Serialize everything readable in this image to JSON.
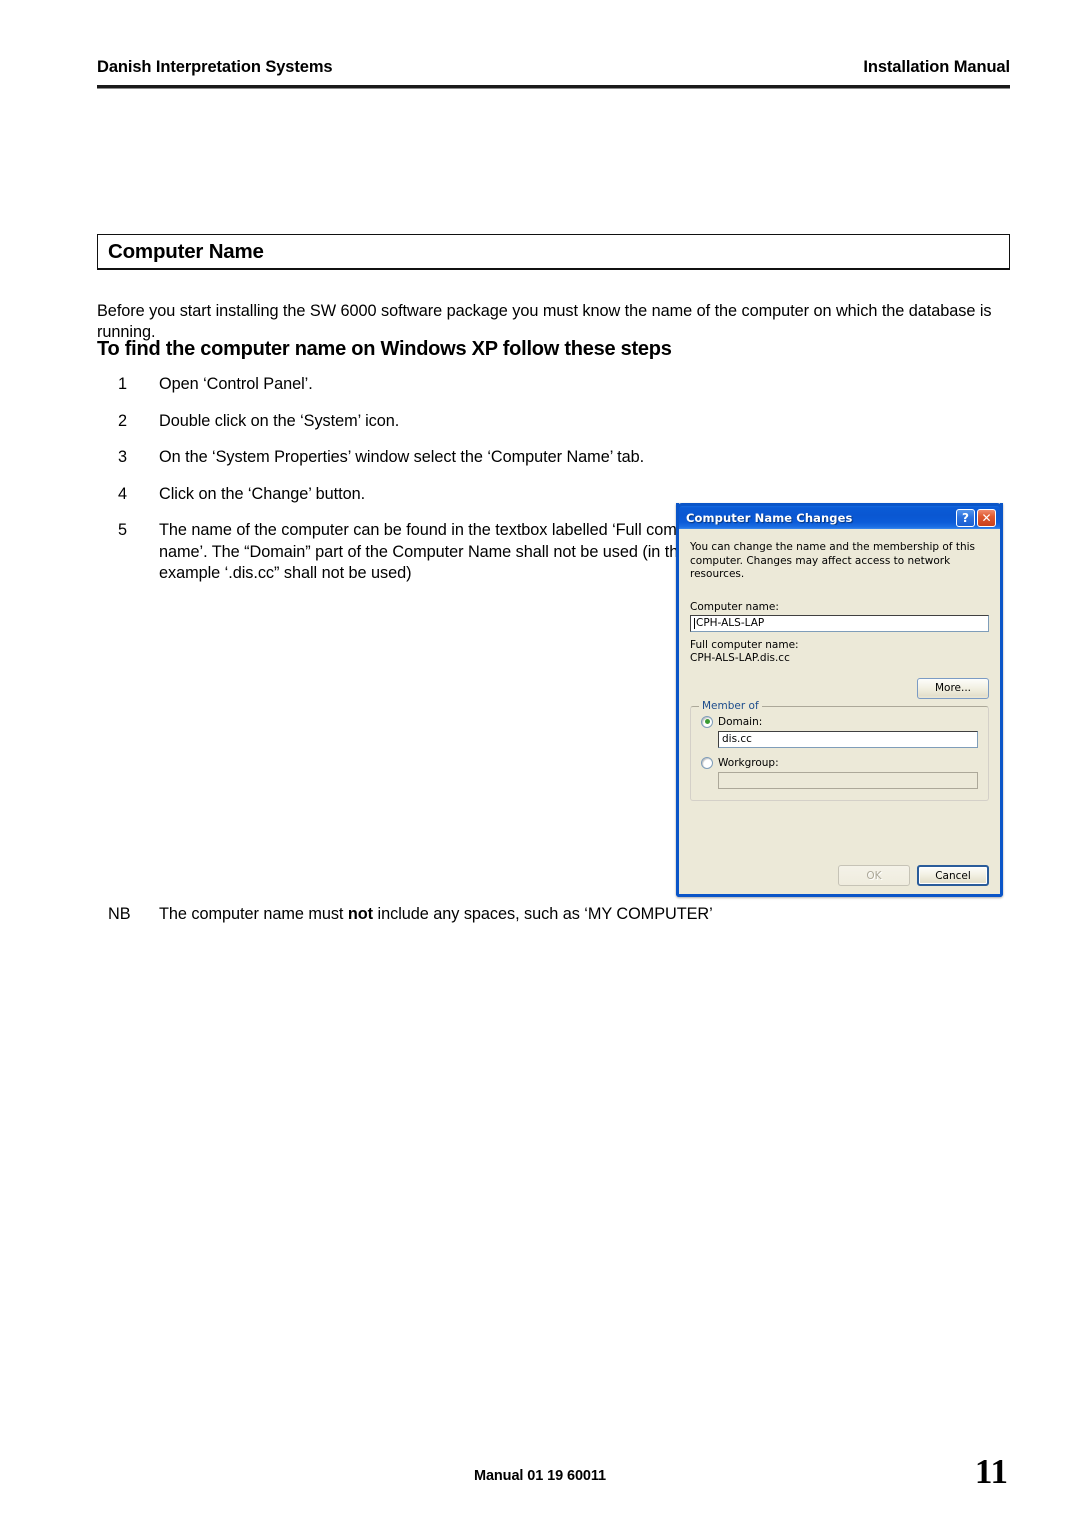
{
  "header": {
    "left": "Danish Interpretation Systems",
    "right": "Installation Manual"
  },
  "section": {
    "heading": "Computer Name",
    "intro": "Before you start installing the SW 6000 software package you must know the name of the computer on which the database is running.",
    "subheading": "To find the computer name on Windows XP follow these steps"
  },
  "steps": [
    {
      "num": "1",
      "text": "Open ‘Control Panel’."
    },
    {
      "num": "2",
      "text": "Double click on the ‘System’ icon."
    },
    {
      "num": "3",
      "text": "On the ‘System Properties’ window select the ‘Computer Name’ tab."
    },
    {
      "num": "4",
      "text": "Click on the ‘Change’ button."
    },
    {
      "num": "5",
      "text": "The name of the computer can be found in the textbox labelled ‘Full computer name’. The “Domain” part of the Computer Name shall not be used (in the example ‘.dis.cc” shall not be used)"
    }
  ],
  "note": {
    "label": "NB",
    "text_before": "The computer name must ",
    "text_bold": "not",
    "text_after": " include any spaces, such as ‘MY COMPUTER’"
  },
  "dialog": {
    "title": "Computer Name Changes",
    "help_button": "?",
    "close_button": "✕",
    "description": "You can change the name and the membership of this computer. Changes may affect access to network resources.",
    "computer_name_label": "Computer name:",
    "computer_name_value": "CPH-ALS-LAP",
    "full_computer_name_label": "Full computer name:",
    "full_computer_name_value": "CPH-ALS-LAP.dis.cc",
    "more_button": "More...",
    "member_of_legend": "Member of",
    "domain_label": "Domain:",
    "domain_value": "dis.cc",
    "workgroup_label": "Workgroup:",
    "workgroup_value": "",
    "ok_button": "OK",
    "cancel_button": "Cancel"
  },
  "footer": {
    "manual": "Manual 01 19 60011",
    "page_number": "11"
  }
}
